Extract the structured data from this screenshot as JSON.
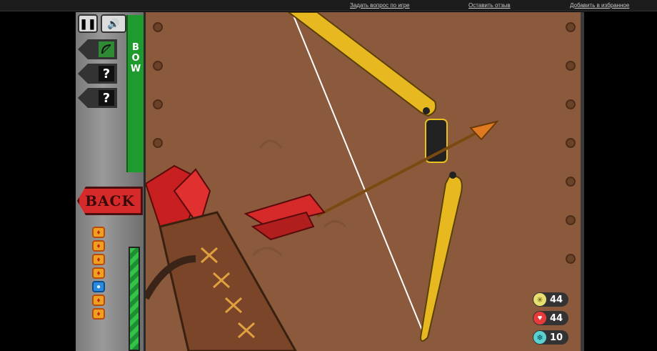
{
  "topbar": {
    "link_question": "Задать вопрос по игре",
    "link_review": "Оставить отзыв",
    "link_favorite": "Добавить в избранное"
  },
  "controls": {
    "pause_icon": "pause-icon",
    "sound_icon": "speaker-icon"
  },
  "weapon_slots": [
    {
      "label": "",
      "icon": "bow-icon"
    },
    {
      "label": "?"
    },
    {
      "label": "?"
    }
  ],
  "weapon_tab": {
    "letters": [
      "B",
      "O",
      "W"
    ]
  },
  "back_button": {
    "label": "BACK"
  },
  "lives": [
    "fire",
    "fire",
    "fire",
    "fire",
    "water",
    "fire",
    "fire"
  ],
  "stats": [
    {
      "name": "attack",
      "icon": "sun-icon",
      "value": "44",
      "color": "#e8e070"
    },
    {
      "name": "health",
      "icon": "heart-icon",
      "value": "44",
      "color": "#e83a3a"
    },
    {
      "name": "frost",
      "icon": "snowflake-icon",
      "value": "10",
      "color": "#5ad2d2"
    }
  ],
  "colors": {
    "wood": "#8b5a3c",
    "bow": "#e8b820",
    "arrow": "#d62a2a",
    "tab": "#1f9a2e"
  }
}
